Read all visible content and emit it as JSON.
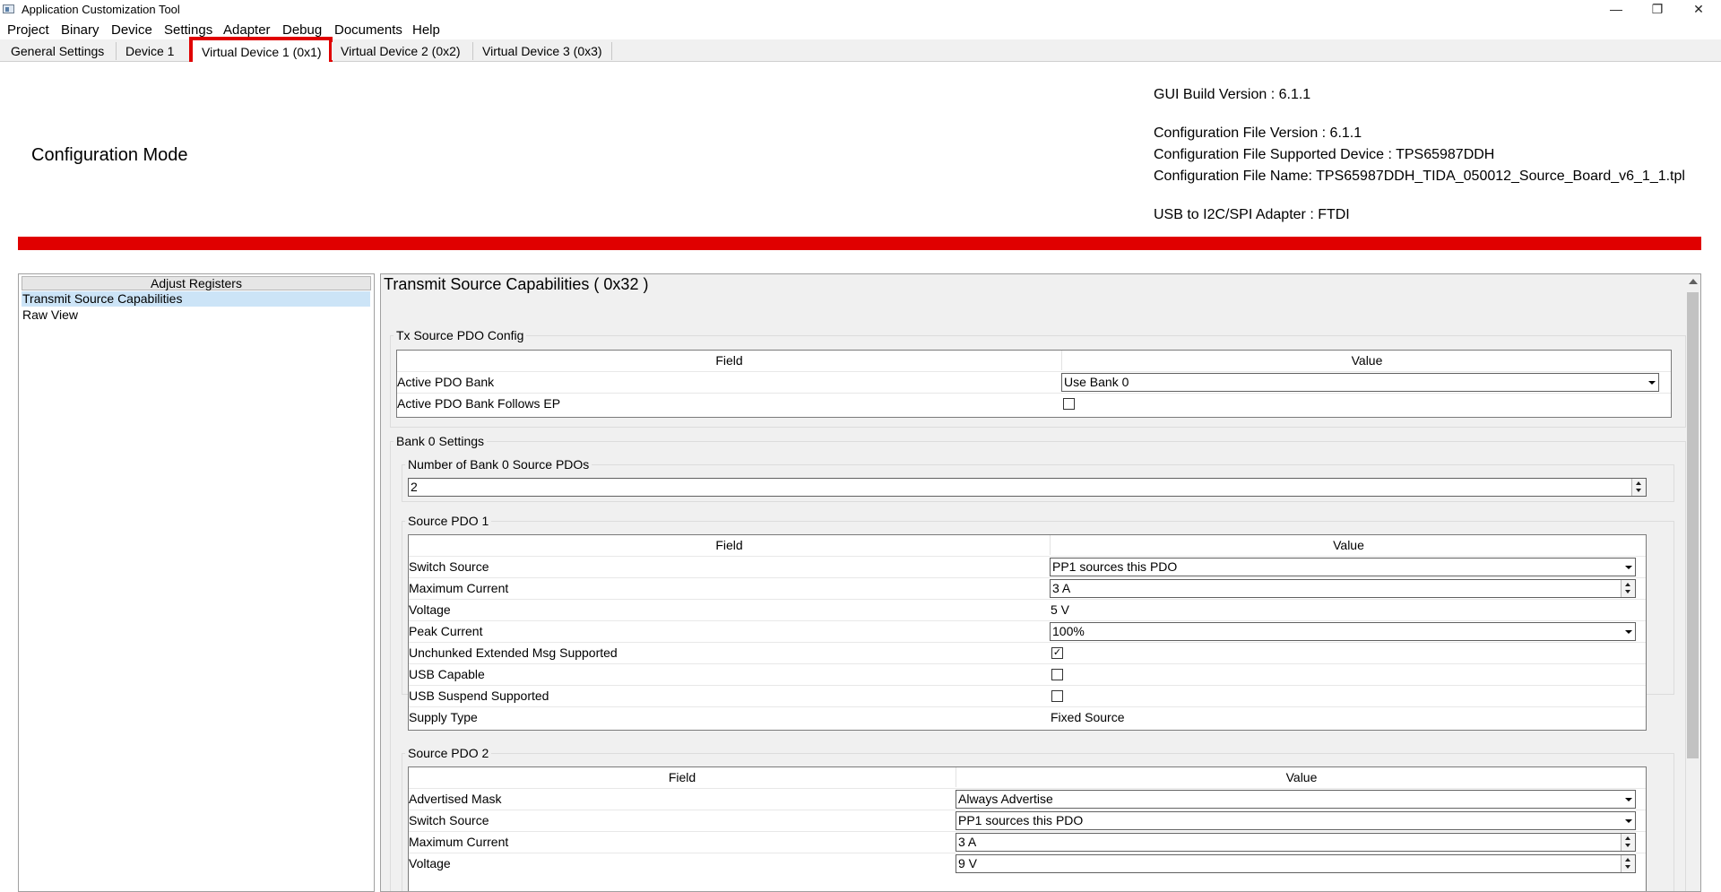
{
  "window": {
    "title": "Application Customization Tool",
    "minimize": "—",
    "maximize": "❐",
    "close": "✕"
  },
  "menu": [
    "Project",
    "Binary",
    "Device",
    "Settings",
    "Adapter",
    "Debug",
    "Documents",
    "Help"
  ],
  "tabs": [
    "General Settings",
    "Device 1",
    "Virtual Device 1 (0x1)",
    "Virtual Device 2 (0x2)",
    "Virtual Device 3 (0x3)"
  ],
  "active_tab": "Virtual Device 1 (0x1)",
  "mode_title": "Configuration Mode",
  "info": {
    "gui_build": "GUI Build Version : 6.1.1",
    "cfg_version": "Configuration File Version : 6.1.1",
    "cfg_device": "Configuration File Supported Device : TPS65987DDH",
    "cfg_name": "Configuration File Name: TPS65987DDH_TIDA_050012_Source_Board_v6_1_1.tpl",
    "adapter": "USB to I2C/SPI Adapter : FTDI"
  },
  "accent_color": "#e00000",
  "left_panel": {
    "header": "Adjust Registers",
    "items": [
      "Transmit Source Capabilities",
      "Raw View"
    ],
    "selected": "Transmit Source Capabilities"
  },
  "right_panel": {
    "title": "Transmit Source Capabilities  ( 0x32 )",
    "field_header": "Field",
    "value_header": "Value",
    "tx_group": {
      "title": "Tx Source PDO Config",
      "rows": [
        {
          "field": "Active PDO Bank",
          "value": "Use Bank 0"
        },
        {
          "field": "Active PDO Bank Follows EP",
          "checked": false
        }
      ]
    },
    "bank0": {
      "title": "Bank 0 Settings",
      "num_pdos_title": "Number of Bank 0 Source PDOs",
      "num_pdos_value": "2",
      "pdo1": {
        "title": "Source PDO 1",
        "rows": [
          {
            "field": "Switch Source",
            "value": "PP1 sources this PDO"
          },
          {
            "field": "Maximum Current",
            "value": "3 A"
          },
          {
            "field": "Voltage",
            "value": "5 V"
          },
          {
            "field": "Peak Current",
            "value": "100%"
          },
          {
            "field": "Unchunked Extended Msg Supported",
            "checked": true
          },
          {
            "field": "USB Capable",
            "checked": false
          },
          {
            "field": "USB Suspend Supported",
            "checked": false
          },
          {
            "field": "Supply Type",
            "value": "Fixed Source"
          }
        ]
      },
      "pdo2": {
        "title": "Source PDO 2",
        "rows": [
          {
            "field": "Advertised Mask",
            "value": "Always Advertise"
          },
          {
            "field": "Switch Source",
            "value": "PP1 sources this PDO"
          },
          {
            "field": "Maximum Current",
            "value": "3 A"
          },
          {
            "field": "Voltage",
            "value": "9 V"
          }
        ]
      }
    }
  }
}
